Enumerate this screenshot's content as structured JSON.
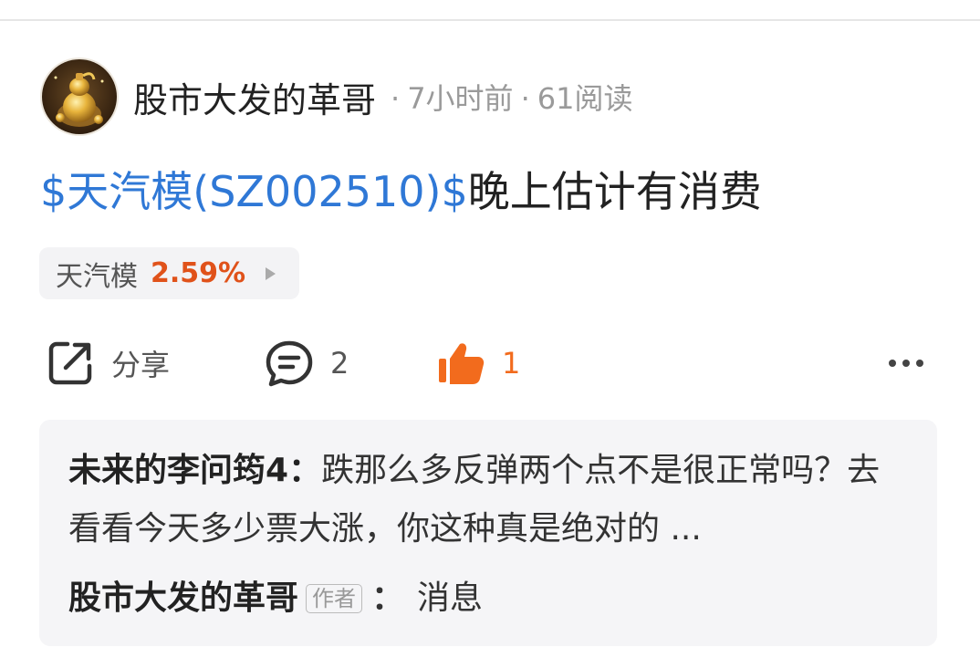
{
  "author": {
    "name": "股市大发的革哥",
    "time": "7小时前",
    "reads": "61阅读",
    "separator": "·"
  },
  "post": {
    "stock_link": "$天汽模(SZ002510)$",
    "text": "晚上估计有消费"
  },
  "stock_chip": {
    "name": "天汽模",
    "change": "2.59%",
    "change_color": "#e0521a"
  },
  "actions": {
    "share_label": "分享",
    "comment_count": "2",
    "like_count": "1",
    "share_icon": "share-icon",
    "comment_icon": "comment-icon",
    "like_icon": "thumbs-up-icon",
    "more_icon": "more-icon",
    "like_color": "#f26b1d"
  },
  "comments": [
    {
      "author": "未来的李问筠4",
      "colon": "：",
      "text": "跌那么多反弹两个点不是很正常吗？去看看今天多少票大涨，你这种真是绝对的 ..."
    },
    {
      "author": "股市大发的革哥",
      "badge": "作者",
      "colon": "：",
      "text": "消息"
    }
  ],
  "colors": {
    "link": "#2f78d6",
    "accent": "#e0521a"
  }
}
